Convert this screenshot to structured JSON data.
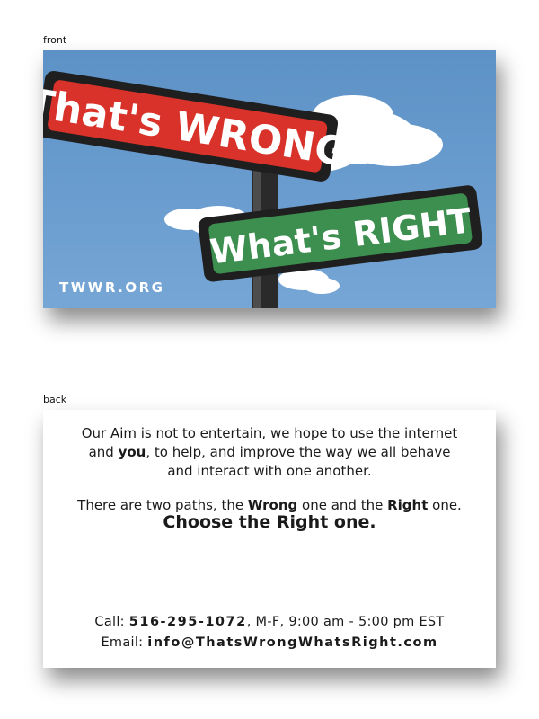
{
  "front": {
    "label": "front",
    "sign_top": "That's WRONG",
    "sign_bottom": "What's RIGHT",
    "website": "TWWR.ORG",
    "colors": {
      "sky": "#6a9ccf",
      "red_sign": "#d8322a",
      "green_sign": "#3d8f4f",
      "sign_frame": "#222222"
    }
  },
  "back": {
    "label": "back",
    "aim": {
      "line1": "Our Aim is not to entertain, we hope to use the internet",
      "line2_a": "and ",
      "line2_bold": "you",
      "line2_b": ", to help, and improve the way we all behave",
      "line3": "and interact with one another."
    },
    "paths": {
      "a": "There are two paths, the ",
      "wrong": "Wrong",
      "b": " one and the ",
      "right": "Right",
      "c": " one."
    },
    "call_to_action": "Choose the Right one.",
    "call": {
      "label": "Call: ",
      "number": "516-295-1072",
      "hours": ", M-F, 9:00 am - 5:00 pm EST"
    },
    "email": {
      "label": "Email: ",
      "address": "info@ThatsWrongWhatsRight.com"
    }
  }
}
